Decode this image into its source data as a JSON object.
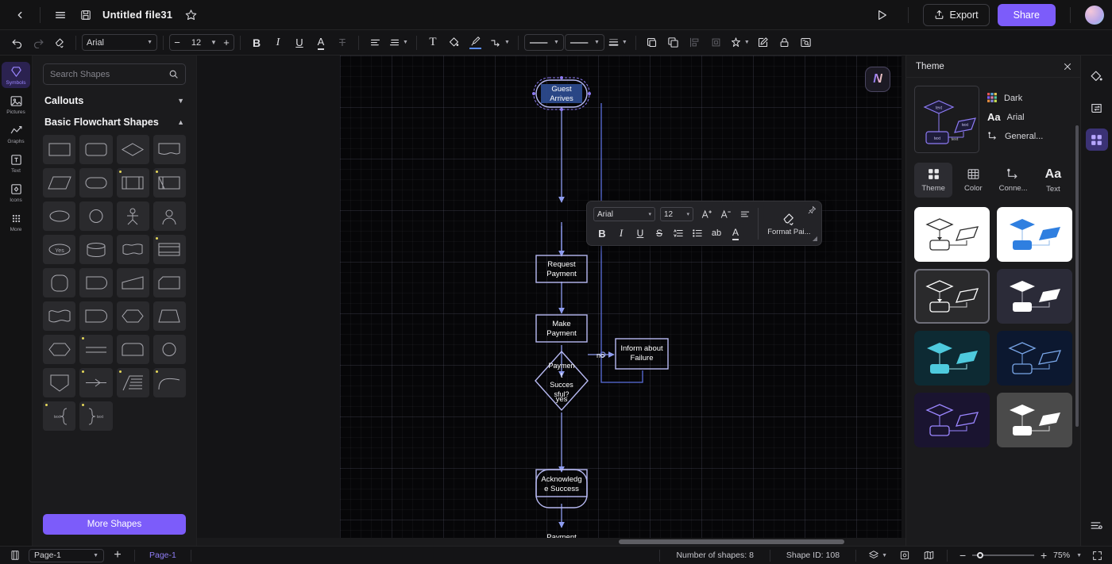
{
  "titlebar": {
    "back_icon": "chevron-left-icon",
    "menu_icon": "hamburger-menu-icon",
    "save_icon": "save-disk-icon",
    "doc_title": "Untitled file31",
    "favorite_icon": "star-icon",
    "present_icon": "play-present-icon",
    "export_label": "Export",
    "share_label": "Share",
    "avatar": "user-avatar"
  },
  "toolbar": {
    "font_family": "Arial",
    "font_size": "12",
    "line_style_value": "————",
    "border_style_value": "————",
    "items": [
      "undo-icon",
      "redo-icon",
      "format-painter-icon",
      "bold-icon",
      "italic-icon",
      "underline-icon",
      "font-color-icon",
      "strikethrough-icon",
      "align-icon",
      "line-spacing-icon",
      "text-box-icon",
      "fill-color-icon",
      "brush-icon",
      "connector-icon",
      "line-weight-icon",
      "bring-forward-icon",
      "duplicate-icon",
      "align-objects-icon",
      "crop-icon",
      "effects-icon",
      "edit-icon",
      "lock-icon",
      "find-icon"
    ]
  },
  "rail": {
    "items": [
      {
        "label": "Symbols",
        "icon": "symbols-icon",
        "active": true
      },
      {
        "label": "Pictures",
        "icon": "picture-icon",
        "active": false
      },
      {
        "label": "Graphs",
        "icon": "graph-icon",
        "active": false
      },
      {
        "label": "Text",
        "icon": "text-icon",
        "active": false
      },
      {
        "label": "Icons",
        "icon": "icons-icon",
        "active": false
      },
      {
        "label": "More",
        "icon": "more-grid-icon",
        "active": false
      }
    ]
  },
  "shapes_panel": {
    "search_placeholder": "Search Shapes",
    "search_value": "",
    "search_icon": "search-icon",
    "sections": [
      {
        "title": "Callouts",
        "expanded": false
      },
      {
        "title": "Basic Flowchart Shapes",
        "expanded": true
      }
    ],
    "more_shapes_label": "More Shapes"
  },
  "float_toolbar": {
    "font_family": "Arial",
    "font_size": "12",
    "format_painter_label": "Format Pai...",
    "pin_icon": "pin-icon",
    "buttons": [
      "increase-font-icon",
      "decrease-font-icon",
      "align-icon",
      "bold-icon",
      "italic-icon",
      "underline-icon",
      "strikethrough-icon",
      "line-spacing-icon",
      "bullet-list-icon",
      "change-case-icon",
      "font-color-icon"
    ],
    "change_case_label": "ab"
  },
  "canvas": {
    "logo_badge": "app-logo-badge",
    "nodes": [
      {
        "id": "start",
        "text": "Guest Arrives",
        "shape": "stadium",
        "selected": true
      },
      {
        "id": "request",
        "text": "Request Payment",
        "shape": "rect"
      },
      {
        "id": "make",
        "text": "Make Payment",
        "shape": "rect"
      },
      {
        "id": "decision",
        "text": "Payment Successful?",
        "shape": "diamond"
      },
      {
        "id": "failure",
        "text": "Inform about Failure",
        "shape": "rect"
      },
      {
        "id": "ack",
        "text": "Acknowledge Success",
        "shape": "rect"
      },
      {
        "id": "end",
        "text": "Payment Completed",
        "shape": "stadium"
      }
    ],
    "edge_labels": {
      "no": "no",
      "yes": "yes"
    }
  },
  "theme_panel": {
    "title": "Theme",
    "close_icon": "close-icon",
    "preview_name": "theme-preview",
    "meta": [
      {
        "label": "Dark",
        "icon": "color-palette-icon"
      },
      {
        "label": "Arial",
        "icon": "font-aa-icon"
      },
      {
        "label": "General...",
        "icon": "connector-icon"
      }
    ],
    "tabs": [
      {
        "label": "Theme",
        "icon": "theme-grid-icon",
        "active": true
      },
      {
        "label": "Color",
        "icon": "color-table-icon",
        "active": false
      },
      {
        "label": "Conne...",
        "icon": "connector-icon",
        "active": false
      },
      {
        "label": "Text",
        "icon": "font-aa-icon",
        "active": false
      }
    ],
    "swatches": [
      {
        "name": "light-white",
        "bg": "#ffffff",
        "stroke": "#2d2d2d",
        "fill": "none",
        "selected": false
      },
      {
        "name": "blue-on-white",
        "bg": "#ffffff",
        "stroke": "#2f7fe0",
        "fill": "#2f7fe0",
        "selected": false
      },
      {
        "name": "dark",
        "bg": "#2a2a2c",
        "stroke": "#ffffff",
        "fill": "none",
        "selected": true
      },
      {
        "name": "dark-navy-solid",
        "bg": "#2b2b38",
        "stroke": "#ffffff",
        "fill": "#ffffff",
        "selected": false
      },
      {
        "name": "teal-on-dark",
        "bg": "#0d2a33",
        "stroke": "#4ecadd",
        "fill": "#4ecadd",
        "selected": false
      },
      {
        "name": "blue-outline-dark",
        "bg": "#0c1830",
        "stroke": "#79a6e8",
        "fill": "none",
        "selected": false
      },
      {
        "name": "purple-outline-dark",
        "bg": "#1a1430",
        "stroke": "#9b86ff",
        "fill": "none",
        "selected": false
      },
      {
        "name": "gray-solid",
        "bg": "#4a4a4a",
        "stroke": "#ffffff",
        "fill": "#ffffff",
        "selected": false
      }
    ]
  },
  "right_rail": {
    "items": [
      {
        "icon": "fill-bucket-icon",
        "active": false
      },
      {
        "icon": "replace-swap-icon",
        "active": false
      },
      {
        "icon": "theme-grid-icon",
        "active": true
      }
    ],
    "bottom_icon": "settings-sliders-icon"
  },
  "statusbar": {
    "page_panel_icon": "page-panel-icon",
    "page_select": "Page-1",
    "add_page_icon": "plus-icon",
    "page_tab": "Page-1",
    "shape_count": "Number of shapes: 8",
    "shape_id": "Shape ID: 108",
    "layers_icon": "layers-icon",
    "focus_icon": "focus-icon",
    "map_icon": "minimap-icon",
    "zoom_minus": "minus-icon",
    "zoom_plus": "plus-icon",
    "zoom_value": "75%",
    "fullscreen_icon": "fullscreen-icon"
  }
}
